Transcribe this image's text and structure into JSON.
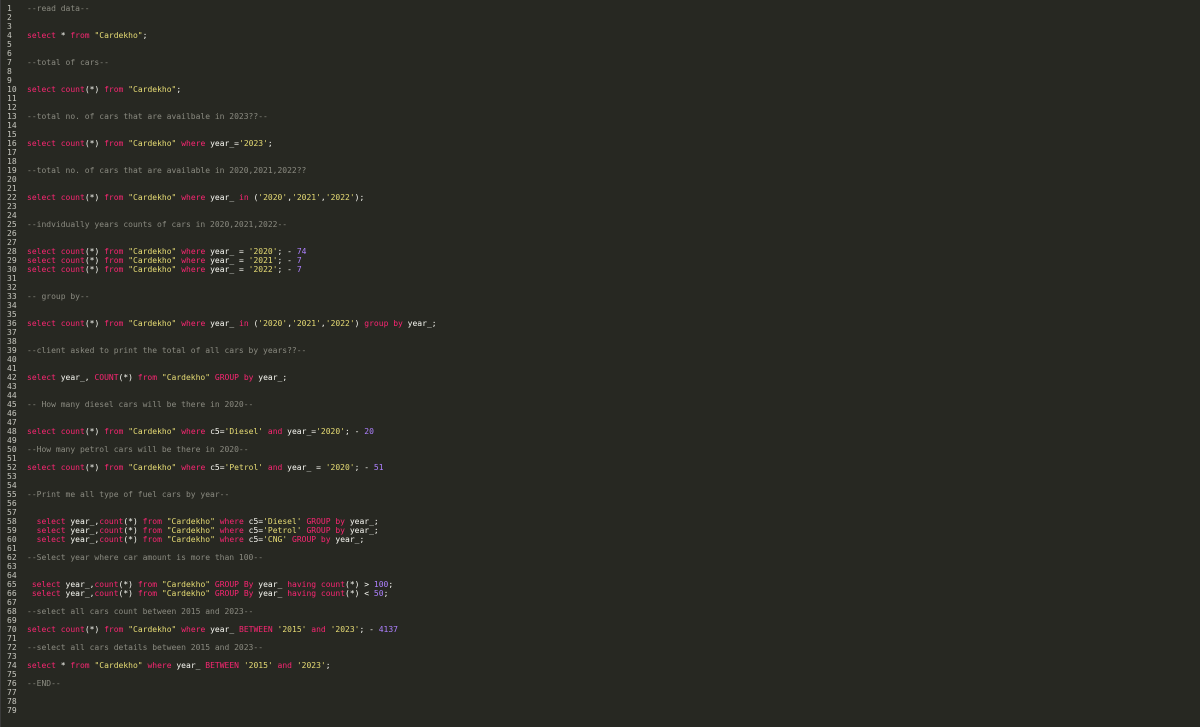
{
  "editor": {
    "colors": {
      "background": "#272822",
      "keyword": "#f92672",
      "string": "#e6db74",
      "number": "#ae81ff",
      "comment": "#8a8a80",
      "plain": "#f8f8f2",
      "line_number": "#c8c8c0"
    },
    "lines": [
      [
        [
          "c",
          "--read data--"
        ]
      ],
      [],
      [],
      [
        [
          "k",
          "select"
        ],
        [
          "p",
          " * "
        ],
        [
          "k",
          "from"
        ],
        [
          "p",
          " "
        ],
        [
          "s",
          "\"Cardekho\""
        ],
        [
          "p",
          ";"
        ]
      ],
      [],
      [],
      [
        [
          "c",
          "--total of cars--"
        ]
      ],
      [],
      [],
      [
        [
          "k",
          "select"
        ],
        [
          "p",
          " "
        ],
        [
          "k",
          "count"
        ],
        [
          "p",
          "(*) "
        ],
        [
          "k",
          "from"
        ],
        [
          "p",
          " "
        ],
        [
          "s",
          "\"Cardekho\""
        ],
        [
          "p",
          ";"
        ]
      ],
      [],
      [],
      [
        [
          "c",
          "--total no. of cars that are availbale in 2023??--"
        ]
      ],
      [],
      [],
      [
        [
          "k",
          "select"
        ],
        [
          "p",
          " "
        ],
        [
          "k",
          "count"
        ],
        [
          "p",
          "(*) "
        ],
        [
          "k",
          "from"
        ],
        [
          "p",
          " "
        ],
        [
          "s",
          "\"Cardekho\""
        ],
        [
          "p",
          " "
        ],
        [
          "k",
          "where"
        ],
        [
          "p",
          " year_="
        ],
        [
          "s",
          "'2023'"
        ],
        [
          "p",
          ";"
        ]
      ],
      [],
      [],
      [
        [
          "c",
          "--total no. of cars that are available in 2020,2021,2022??"
        ]
      ],
      [],
      [],
      [
        [
          "k",
          "select"
        ],
        [
          "p",
          " "
        ],
        [
          "k",
          "count"
        ],
        [
          "p",
          "(*) "
        ],
        [
          "k",
          "from"
        ],
        [
          "p",
          " "
        ],
        [
          "s",
          "\"Cardekho\""
        ],
        [
          "p",
          " "
        ],
        [
          "k",
          "where"
        ],
        [
          "p",
          " year_ "
        ],
        [
          "k",
          "in"
        ],
        [
          "p",
          " ("
        ],
        [
          "s",
          "'2020'"
        ],
        [
          "p",
          ","
        ],
        [
          "s",
          "'2021'"
        ],
        [
          "p",
          ","
        ],
        [
          "s",
          "'2022'"
        ],
        [
          "p",
          ");"
        ]
      ],
      [],
      [],
      [
        [
          "c",
          "--indvidually years counts of cars in 2020,2021,2022--"
        ]
      ],
      [],
      [],
      [
        [
          "k",
          "select"
        ],
        [
          "p",
          " "
        ],
        [
          "k",
          "count"
        ],
        [
          "p",
          "(*) "
        ],
        [
          "k",
          "from"
        ],
        [
          "p",
          " "
        ],
        [
          "s",
          "\"Cardekho\""
        ],
        [
          "p",
          " "
        ],
        [
          "k",
          "where"
        ],
        [
          "p",
          " year_ = "
        ],
        [
          "s",
          "'2020'"
        ],
        [
          "p",
          "; - "
        ],
        [
          "n",
          "74"
        ]
      ],
      [
        [
          "k",
          "select"
        ],
        [
          "p",
          " "
        ],
        [
          "k",
          "count"
        ],
        [
          "p",
          "(*) "
        ],
        [
          "k",
          "from"
        ],
        [
          "p",
          " "
        ],
        [
          "s",
          "\"Cardekho\""
        ],
        [
          "p",
          " "
        ],
        [
          "k",
          "where"
        ],
        [
          "p",
          " year_ = "
        ],
        [
          "s",
          "'2021'"
        ],
        [
          "p",
          "; - "
        ],
        [
          "n",
          "7"
        ]
      ],
      [
        [
          "k",
          "select"
        ],
        [
          "p",
          " "
        ],
        [
          "k",
          "count"
        ],
        [
          "p",
          "(*) "
        ],
        [
          "k",
          "from"
        ],
        [
          "p",
          " "
        ],
        [
          "s",
          "\"Cardekho\""
        ],
        [
          "p",
          " "
        ],
        [
          "k",
          "where"
        ],
        [
          "p",
          " year_ = "
        ],
        [
          "s",
          "'2022'"
        ],
        [
          "p",
          "; - "
        ],
        [
          "n",
          "7"
        ]
      ],
      [],
      [],
      [
        [
          "c",
          "-- group by--"
        ]
      ],
      [],
      [],
      [
        [
          "k",
          "select"
        ],
        [
          "p",
          " "
        ],
        [
          "k",
          "count"
        ],
        [
          "p",
          "(*) "
        ],
        [
          "k",
          "from"
        ],
        [
          "p",
          " "
        ],
        [
          "s",
          "\"Cardekho\""
        ],
        [
          "p",
          " "
        ],
        [
          "k",
          "where"
        ],
        [
          "p",
          " year_ "
        ],
        [
          "k",
          "in"
        ],
        [
          "p",
          " ("
        ],
        [
          "s",
          "'2020'"
        ],
        [
          "p",
          ","
        ],
        [
          "s",
          "'2021'"
        ],
        [
          "p",
          ","
        ],
        [
          "s",
          "'2022'"
        ],
        [
          "p",
          ") "
        ],
        [
          "k",
          "group"
        ],
        [
          "p",
          " "
        ],
        [
          "k",
          "by"
        ],
        [
          "p",
          " year_;"
        ]
      ],
      [],
      [],
      [
        [
          "c",
          "--client asked to print the total of all cars by years??--"
        ]
      ],
      [],
      [],
      [
        [
          "k",
          "select"
        ],
        [
          "p",
          " year_, "
        ],
        [
          "k",
          "COUNT"
        ],
        [
          "p",
          "(*) "
        ],
        [
          "k",
          "from"
        ],
        [
          "p",
          " "
        ],
        [
          "s",
          "\"Cardekho\""
        ],
        [
          "p",
          " "
        ],
        [
          "k",
          "GROUP"
        ],
        [
          "p",
          " "
        ],
        [
          "k",
          "by"
        ],
        [
          "p",
          " year_;"
        ]
      ],
      [],
      [],
      [
        [
          "c",
          "-- How many diesel cars will be there in 2020--"
        ]
      ],
      [],
      [],
      [
        [
          "k",
          "select"
        ],
        [
          "p",
          " "
        ],
        [
          "k",
          "count"
        ],
        [
          "p",
          "(*) "
        ],
        [
          "k",
          "from"
        ],
        [
          "p",
          " "
        ],
        [
          "s",
          "\"Cardekho\""
        ],
        [
          "p",
          " "
        ],
        [
          "k",
          "where"
        ],
        [
          "p",
          " c5="
        ],
        [
          "s",
          "'Diesel'"
        ],
        [
          "p",
          " "
        ],
        [
          "k",
          "and"
        ],
        [
          "p",
          " year_="
        ],
        [
          "s",
          "'2020'"
        ],
        [
          "p",
          "; - "
        ],
        [
          "n",
          "20"
        ]
      ],
      [],
      [
        [
          "c",
          "--How many petrol cars will be there in 2020--"
        ]
      ],
      [],
      [
        [
          "k",
          "select"
        ],
        [
          "p",
          " "
        ],
        [
          "k",
          "count"
        ],
        [
          "p",
          "(*) "
        ],
        [
          "k",
          "from"
        ],
        [
          "p",
          " "
        ],
        [
          "s",
          "\"Cardekho\""
        ],
        [
          "p",
          " "
        ],
        [
          "k",
          "where"
        ],
        [
          "p",
          " c5="
        ],
        [
          "s",
          "'Petrol'"
        ],
        [
          "p",
          " "
        ],
        [
          "k",
          "and"
        ],
        [
          "p",
          " year_ = "
        ],
        [
          "s",
          "'2020'"
        ],
        [
          "p",
          "; - "
        ],
        [
          "n",
          "51"
        ]
      ],
      [],
      [],
      [
        [
          "c",
          "--Print me all type of fuel cars by year--"
        ]
      ],
      [],
      [],
      [
        [
          "p",
          "  "
        ],
        [
          "k",
          "select"
        ],
        [
          "p",
          " year_,"
        ],
        [
          "k",
          "count"
        ],
        [
          "p",
          "(*) "
        ],
        [
          "k",
          "from"
        ],
        [
          "p",
          " "
        ],
        [
          "s",
          "\"Cardekho\""
        ],
        [
          "p",
          " "
        ],
        [
          "k",
          "where"
        ],
        [
          "p",
          " c5="
        ],
        [
          "s",
          "'Diesel'"
        ],
        [
          "p",
          " "
        ],
        [
          "k",
          "GROUP"
        ],
        [
          "p",
          " "
        ],
        [
          "k",
          "by"
        ],
        [
          "p",
          " year_;"
        ]
      ],
      [
        [
          "p",
          "  "
        ],
        [
          "k",
          "select"
        ],
        [
          "p",
          " year_,"
        ],
        [
          "k",
          "count"
        ],
        [
          "p",
          "(*) "
        ],
        [
          "k",
          "from"
        ],
        [
          "p",
          " "
        ],
        [
          "s",
          "\"Cardekho\""
        ],
        [
          "p",
          " "
        ],
        [
          "k",
          "where"
        ],
        [
          "p",
          " c5="
        ],
        [
          "s",
          "'Petrol'"
        ],
        [
          "p",
          " "
        ],
        [
          "k",
          "GROUP"
        ],
        [
          "p",
          " "
        ],
        [
          "k",
          "by"
        ],
        [
          "p",
          " year_;"
        ]
      ],
      [
        [
          "p",
          "  "
        ],
        [
          "k",
          "select"
        ],
        [
          "p",
          " year_,"
        ],
        [
          "k",
          "count"
        ],
        [
          "p",
          "(*) "
        ],
        [
          "k",
          "from"
        ],
        [
          "p",
          " "
        ],
        [
          "s",
          "\"Cardekho\""
        ],
        [
          "p",
          " "
        ],
        [
          "k",
          "where"
        ],
        [
          "p",
          " c5="
        ],
        [
          "s",
          "'CNG'"
        ],
        [
          "p",
          " "
        ],
        [
          "k",
          "GROUP"
        ],
        [
          "p",
          " "
        ],
        [
          "k",
          "by"
        ],
        [
          "p",
          " year_;"
        ]
      ],
      [],
      [
        [
          "c",
          "--Select year where car amount is more than 100--"
        ]
      ],
      [],
      [],
      [
        [
          "p",
          " "
        ],
        [
          "k",
          "select"
        ],
        [
          "p",
          " year_,"
        ],
        [
          "k",
          "count"
        ],
        [
          "p",
          "(*) "
        ],
        [
          "k",
          "from"
        ],
        [
          "p",
          " "
        ],
        [
          "s",
          "\"Cardekho\""
        ],
        [
          "p",
          " "
        ],
        [
          "k",
          "GROUP"
        ],
        [
          "p",
          " "
        ],
        [
          "k",
          "By"
        ],
        [
          "p",
          " year_ "
        ],
        [
          "k",
          "having"
        ],
        [
          "p",
          " "
        ],
        [
          "k",
          "count"
        ],
        [
          "p",
          "(*) > "
        ],
        [
          "n",
          "100"
        ],
        [
          "p",
          ";"
        ]
      ],
      [
        [
          "p",
          " "
        ],
        [
          "k",
          "select"
        ],
        [
          "p",
          " year_,"
        ],
        [
          "k",
          "count"
        ],
        [
          "p",
          "(*) "
        ],
        [
          "k",
          "from"
        ],
        [
          "p",
          " "
        ],
        [
          "s",
          "\"Cardekho\""
        ],
        [
          "p",
          " "
        ],
        [
          "k",
          "GROUP"
        ],
        [
          "p",
          " "
        ],
        [
          "k",
          "By"
        ],
        [
          "p",
          " year_ "
        ],
        [
          "k",
          "having"
        ],
        [
          "p",
          " "
        ],
        [
          "k",
          "count"
        ],
        [
          "p",
          "(*) < "
        ],
        [
          "n",
          "50"
        ],
        [
          "p",
          ";"
        ]
      ],
      [],
      [
        [
          "c",
          "--select all cars count between 2015 and 2023--"
        ]
      ],
      [],
      [
        [
          "k",
          "select"
        ],
        [
          "p",
          " "
        ],
        [
          "k",
          "count"
        ],
        [
          "p",
          "(*) "
        ],
        [
          "k",
          "from"
        ],
        [
          "p",
          " "
        ],
        [
          "s",
          "\"Cardekho\""
        ],
        [
          "p",
          " "
        ],
        [
          "k",
          "where"
        ],
        [
          "p",
          " year_ "
        ],
        [
          "k",
          "BETWEEN"
        ],
        [
          "p",
          " "
        ],
        [
          "s",
          "'2015'"
        ],
        [
          "p",
          " "
        ],
        [
          "k",
          "and"
        ],
        [
          "p",
          " "
        ],
        [
          "s",
          "'2023'"
        ],
        [
          "p",
          "; - "
        ],
        [
          "n",
          "4137"
        ]
      ],
      [],
      [
        [
          "c",
          "--select all cars details between 2015 and 2023--"
        ]
      ],
      [],
      [
        [
          "k",
          "select"
        ],
        [
          "p",
          " * "
        ],
        [
          "k",
          "from"
        ],
        [
          "p",
          " "
        ],
        [
          "s",
          "\"Cardekho\""
        ],
        [
          "p",
          " "
        ],
        [
          "k",
          "where"
        ],
        [
          "p",
          " year_ "
        ],
        [
          "k",
          "BETWEEN"
        ],
        [
          "p",
          " "
        ],
        [
          "s",
          "'2015'"
        ],
        [
          "p",
          " "
        ],
        [
          "k",
          "and"
        ],
        [
          "p",
          " "
        ],
        [
          "s",
          "'2023'"
        ],
        [
          "p",
          ";"
        ]
      ],
      [],
      [
        [
          "c",
          "--END--"
        ]
      ],
      [],
      [],
      []
    ]
  }
}
